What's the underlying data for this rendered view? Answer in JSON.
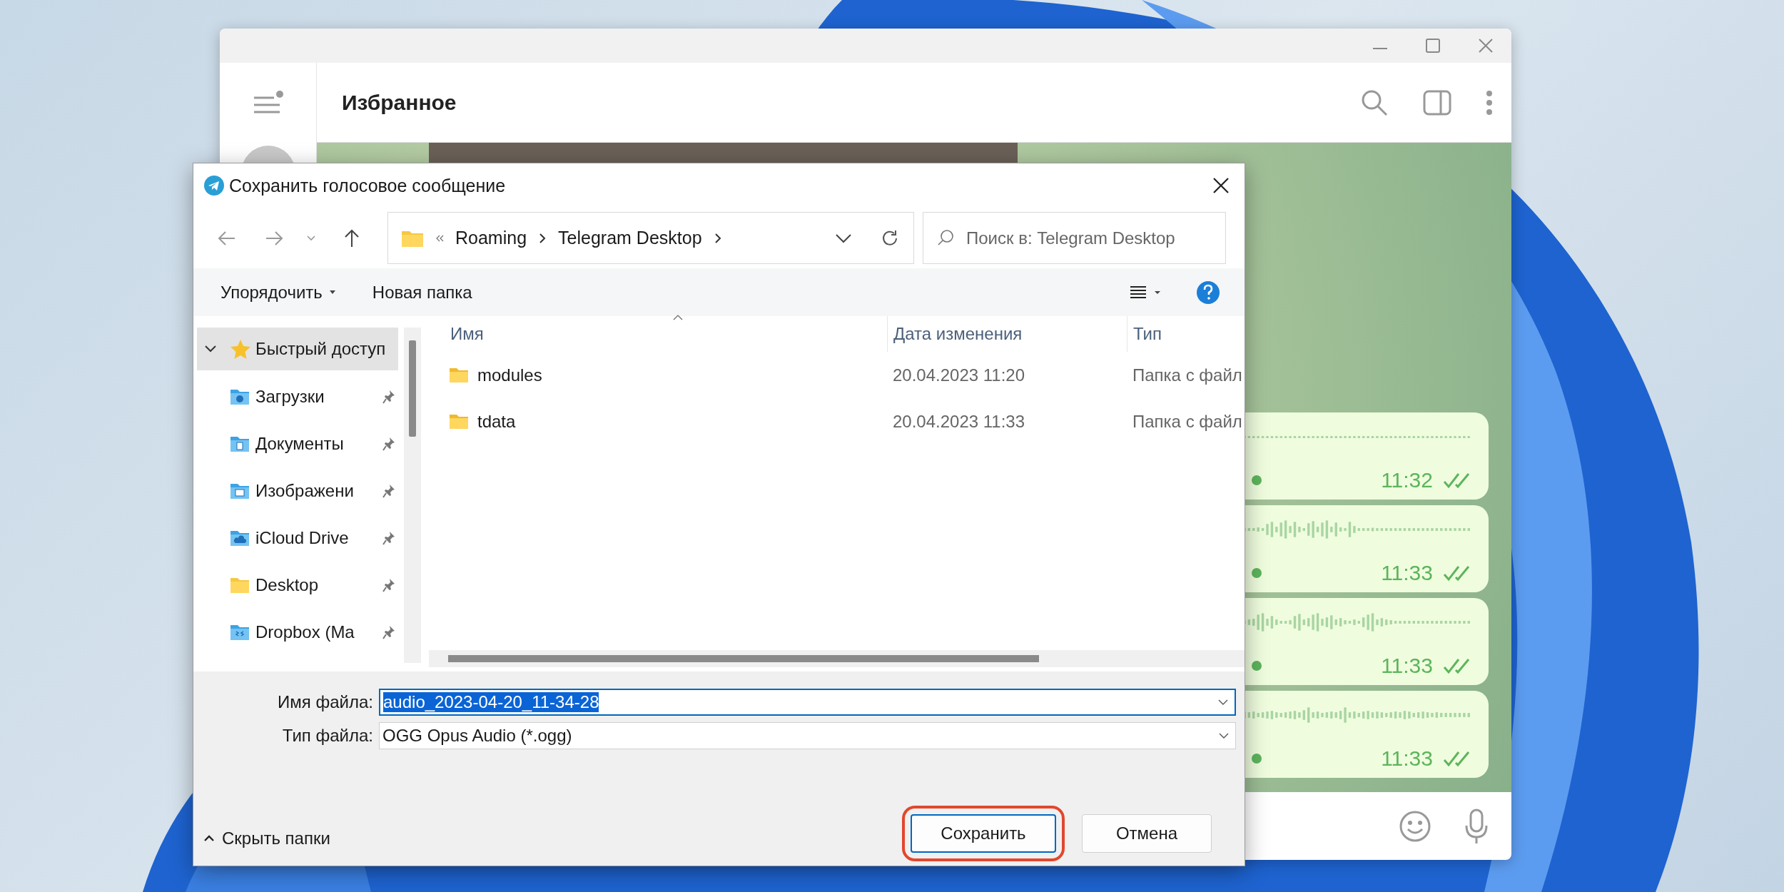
{
  "telegram": {
    "chat_title": "Избранное",
    "messages": [
      {
        "time": "11:32",
        "read": true
      },
      {
        "time": "11:33",
        "read": true
      },
      {
        "time": "11:33",
        "read": true
      },
      {
        "time": "11:33",
        "read": true
      }
    ]
  },
  "dialog": {
    "title": "Сохранить голосовое сообщение",
    "breadcrumb": [
      "Roaming",
      "Telegram Desktop"
    ],
    "search": {
      "placeholder": "Поиск в: Telegram Desktop"
    },
    "toolbar": [
      {
        "label": "Упорядочить",
        "dropdown": true
      },
      {
        "label": "Новая папка",
        "dropdown": false
      }
    ],
    "nav": [
      {
        "label": "Быстрый доступ",
        "expanded": true,
        "selected": true,
        "children": [
          {
            "label": "Загрузки",
            "kind": "downloads",
            "pinned": true
          },
          {
            "label": "Документы",
            "kind": "documents",
            "pinned": true
          },
          {
            "label": "Изображени",
            "kind": "pictures",
            "pinned": true
          },
          {
            "label": "iCloud Drive",
            "kind": "cloud",
            "pinned": true
          },
          {
            "label": "Desktop",
            "kind": "folder",
            "pinned": true
          },
          {
            "label": "Dropbox (Ma",
            "kind": "dropbox",
            "pinned": true
          }
        ]
      }
    ],
    "columns": [
      "Имя",
      "Дата изменения",
      "Тип"
    ],
    "files": [
      {
        "name": "modules",
        "date": "20.04.2023 11:20",
        "type": "Папка с файл"
      },
      {
        "name": "tdata",
        "date": "20.04.2023 11:33",
        "type": "Папка с файл"
      }
    ],
    "file_name": {
      "label": "Имя файла:",
      "value": "audio_2023-04-20_11-34-28",
      "value_selected": true
    },
    "file_type": {
      "label": "Тип файла:",
      "value": "OGG Opus Audio (*.ogg)"
    },
    "hide_folders": "Скрыть папки",
    "buttons": [
      {
        "label": "Сохранить",
        "kind": "primary",
        "highlighted": true
      },
      {
        "label": "Отмена",
        "kind": "secondary",
        "highlighted": false
      }
    ]
  }
}
